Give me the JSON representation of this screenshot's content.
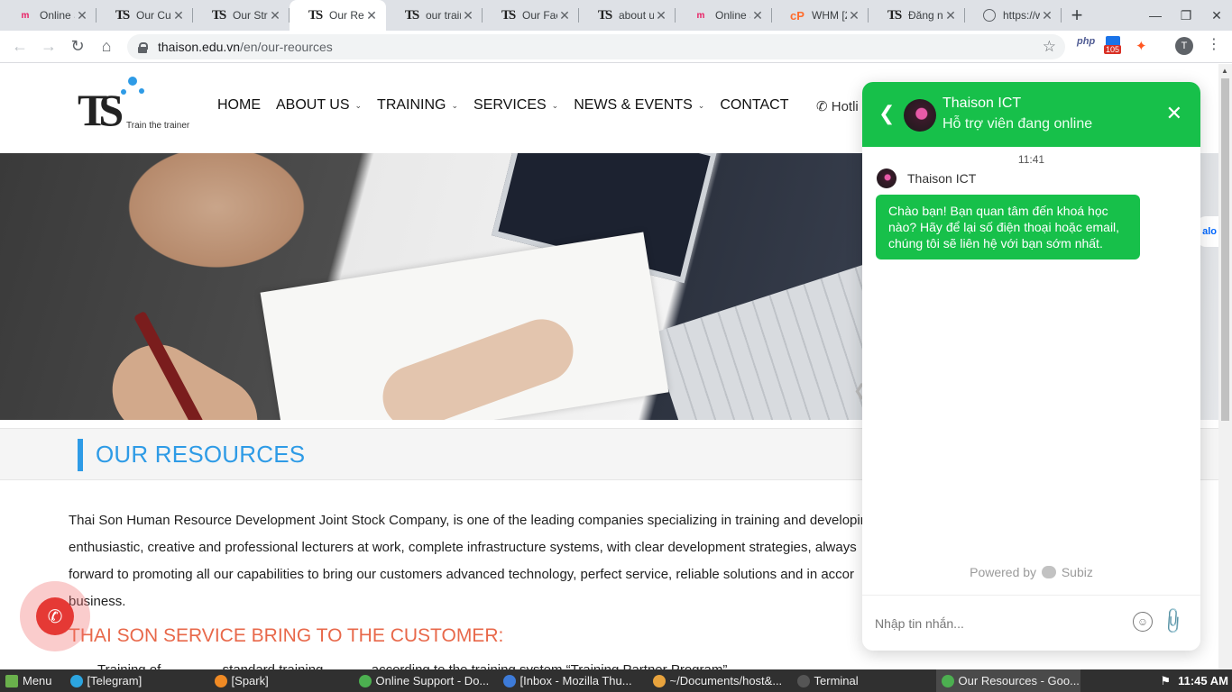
{
  "browser": {
    "tabs": [
      {
        "title": "Online S",
        "icon": "mozilla-icon"
      },
      {
        "title": "Our Cus",
        "icon": "ts-icon"
      },
      {
        "title": "Our Stra",
        "icon": "ts-icon"
      },
      {
        "title": "Our Res",
        "icon": "ts-icon",
        "active": true
      },
      {
        "title": "our train",
        "icon": "ts-icon"
      },
      {
        "title": "Our Fac",
        "icon": "ts-icon"
      },
      {
        "title": "about u",
        "icon": "ts-icon"
      },
      {
        "title": "Online S",
        "icon": "mozilla-icon"
      },
      {
        "title": "WHM [2",
        "icon": "cpanel-icon"
      },
      {
        "title": "Đăng nh",
        "icon": "ts-icon"
      },
      {
        "title": "https://w",
        "icon": "globe-icon"
      }
    ],
    "url_host": "thaison.edu.vn",
    "url_path": "/en/our-reources",
    "ext_php": "php",
    "ext_mail_count": "105",
    "profile_initial": "T"
  },
  "site": {
    "logo_tagline": "Train the trainer",
    "menu": [
      {
        "label": "HOME",
        "has_caret": false
      },
      {
        "label": "ABOUT US",
        "has_caret": true
      },
      {
        "label": "TRAINING",
        "has_caret": true
      },
      {
        "label": "SERVICES",
        "has_caret": true
      },
      {
        "label": "NEWS & EVENTS",
        "has_caret": true
      },
      {
        "label": "CONTACT",
        "has_caret": false
      }
    ],
    "hotline": "Hotli",
    "zalo": "alo",
    "page_title": "OUR RESOURCES",
    "body_lines": [
      "Thai Son Human Resource Development Joint Stock Company, is one of the leading companies specializing in training and developing",
      "enthusiastic, creative and professional lecturers at work, complete infrastructure systems, with clear development strategies, always",
      "forward to promoting all our capabilities to bring our customers advanced technology, perfect service, reliable solutions and in accor",
      "business."
    ],
    "subheading": "THAI SON SERVICE BRING TO THE CUSTOMER:",
    "bullet": "Training of ………… standard training ……… according to the training system “Training Partner Program”"
  },
  "chat": {
    "agent_name": "Thaison ICT",
    "status": "Hỗ trợ viên đang online",
    "time": "11:41",
    "message": "Chào bạn! Bạn quan tâm đến khoá học nào? Hãy để lại số điện thoại hoặc email, chúng tôi sẽ liên hệ với bạn sớm nhất.",
    "powered_prefix": "Powered by",
    "powered_brand": "Subiz",
    "input_placeholder": "Nhập tin nhắn..."
  },
  "taskbar": {
    "menu_label": "Menu",
    "items": [
      {
        "label": "[Telegram]",
        "icon_color": "#2ca5e0"
      },
      {
        "label": "[Spark]",
        "icon_color": "#f08a24"
      },
      {
        "label": "Online Support - Do...",
        "icon_color": "#4caf50"
      },
      {
        "label": "[Inbox - Mozilla Thu...",
        "icon_color": "#3d7bd9"
      },
      {
        "label": "~/Documents/host&...",
        "icon_color": "#e8a33d"
      },
      {
        "label": "Terminal",
        "icon_color": "#555555"
      },
      {
        "label": "Our Resources - Goo...",
        "icon_color": "#4caf50",
        "active": true
      }
    ],
    "clock": "11:45 AM"
  },
  "colors": {
    "accent_blue": "#2e9be6",
    "chat_green": "#17c04a",
    "subheading_orange": "#e8684a",
    "call_red": "#e53935"
  }
}
